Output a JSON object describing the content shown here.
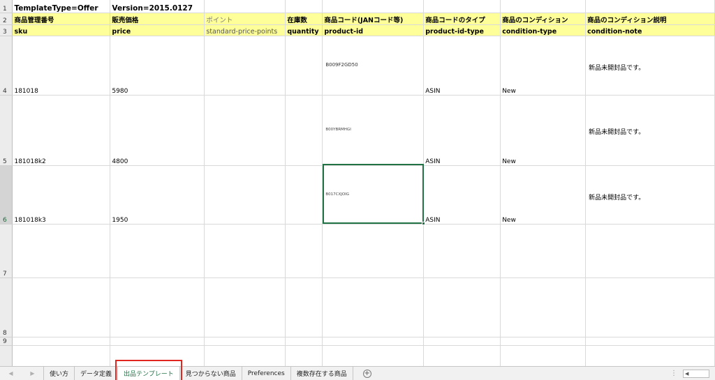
{
  "rows": {
    "r1": {
      "num": "1",
      "a": "TemplateType=Offer",
      "b": "Version=2015.0127"
    },
    "r2": {
      "num": "2",
      "cells": [
        "商品管理番号",
        "販売価格",
        "ポイント",
        "在庫数",
        "商品コード(JANコード等)",
        "商品コードのタイプ",
        "商品のコンディション",
        "商品のコンディション説明"
      ]
    },
    "r3": {
      "num": "3",
      "cells": [
        "sku",
        "price",
        "standard-price-points",
        "quantity",
        "product-id",
        "product-id-type",
        "condition-type",
        "condition-note"
      ]
    },
    "r4": {
      "num": "4",
      "sku": "181018",
      "price": "5980",
      "product_id": "B009F2GD50",
      "type": "ASIN",
      "condition": "New",
      "note": "新品未開封品です。"
    },
    "r5": {
      "num": "5",
      "sku": "181018k2",
      "price": "4800",
      "product_id": "B00YBRMHGI",
      "type": "ASIN",
      "condition": "New",
      "note": "新品未開封品です。"
    },
    "r6": {
      "num": "6",
      "sku": "181018k3",
      "price": "1950",
      "product_id": "B017CXJOIG",
      "type": "ASIN",
      "condition": "New",
      "note": "新品未開封品です。"
    },
    "r7": {
      "num": "7"
    },
    "r8": {
      "num": "8"
    },
    "r9": {
      "num": "9"
    }
  },
  "tabs": {
    "t1": "使い方",
    "t2": "データ定義",
    "t3": "出品テンプレート",
    "t4": "見つからない商品",
    "t5": "Preferences",
    "t6": "複数存在する商品"
  },
  "colors": {
    "selection": "#217346",
    "header_fill": "#ffff99",
    "highlight": "#e0261f"
  }
}
